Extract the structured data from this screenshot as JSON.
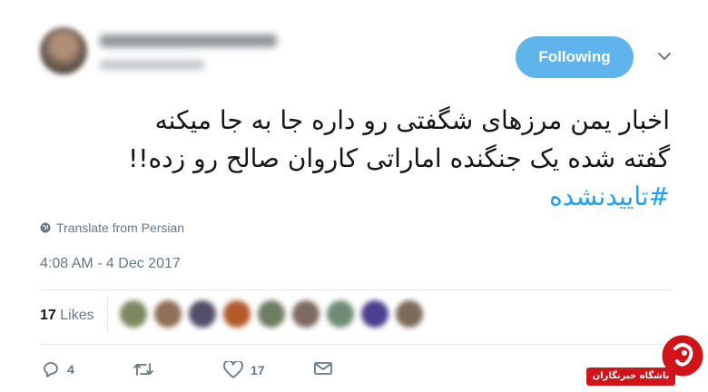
{
  "header": {
    "follow_label": "Following"
  },
  "tweet": {
    "lines": [
      "اخبار یمن مرزهای شگفتی رو داره جا به جا میکنه",
      "گفته شده یک جنگنده اماراتی کاروان صالح رو زده!!"
    ],
    "hashtag": "#تاییدنشده",
    "translate_label": "Translate from Persian",
    "timestamp": "4:08 AM - 4 Dec 2017"
  },
  "stats": {
    "likes_count": "17",
    "likes_label": "Likes"
  },
  "actions": {
    "reply_count": "4",
    "retweet_count": "",
    "like_count": "17"
  },
  "watermark": {
    "text": "باشگاه خبرنگاران"
  },
  "colors": {
    "accent": "#1da1f2",
    "button": "#5fb4ec",
    "muted": "#657786",
    "watermark_red": "#d0141a"
  },
  "icons": [
    "globe-icon",
    "reply-icon",
    "retweet-icon",
    "heart-icon",
    "mail-icon",
    "chevron-down-icon"
  ]
}
